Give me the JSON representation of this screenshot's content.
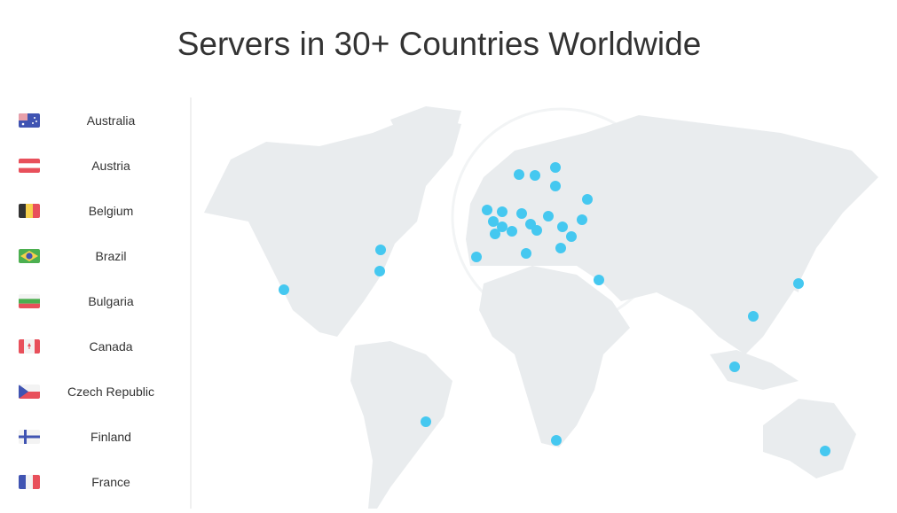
{
  "header": {
    "title": "Servers in 30+ Countries Worldwide"
  },
  "sidebar": {
    "items": [
      {
        "label": "Australia",
        "flag": "australia-flag"
      },
      {
        "label": "Austria",
        "flag": "austria-flag"
      },
      {
        "label": "Belgium",
        "flag": "belgium-flag"
      },
      {
        "label": "Brazil",
        "flag": "brazil-flag"
      },
      {
        "label": "Bulgaria",
        "flag": "bulgaria-flag"
      },
      {
        "label": "Canada",
        "flag": "canada-flag"
      },
      {
        "label": "Czech Republic",
        "flag": "czech-republic-flag"
      },
      {
        "label": "Finland",
        "flag": "finland-flag"
      },
      {
        "label": "France",
        "flag": "france-flag"
      }
    ]
  },
  "colors": {
    "server_dot": "#45c8f0",
    "land": "#e9ecee",
    "red": "#e8505b",
    "blue": "#4054b2",
    "yellow": "#f6d04d",
    "green": "#4caf50",
    "dark": "#333333"
  }
}
